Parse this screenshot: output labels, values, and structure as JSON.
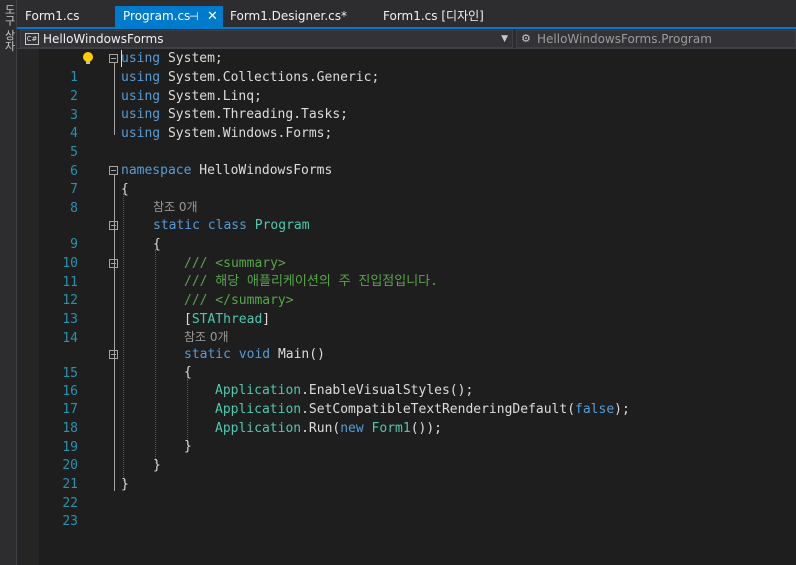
{
  "toolstrip": {
    "label": "도구 상자"
  },
  "tabs": [
    {
      "label": "Form1.cs",
      "active": false
    },
    {
      "label": "Program.cs",
      "active": true
    },
    {
      "label": "Form1.Designer.cs*",
      "active": false
    },
    {
      "label": "Form1.cs [디자인]",
      "active": false
    }
  ],
  "navbar": {
    "project": "HelloWindowsForms",
    "class": "HelloWindowsForms.Program"
  },
  "code": {
    "lines": [
      {
        "n": "1",
        "t": [
          "using",
          " System;"
        ]
      },
      {
        "n": "2",
        "t": [
          "using",
          " System.Collections.Generic;"
        ]
      },
      {
        "n": "3",
        "t": [
          "using",
          " System.Linq;"
        ]
      },
      {
        "n": "4",
        "t": [
          "using",
          " System.Threading.Tasks;"
        ]
      },
      {
        "n": "5",
        "t": [
          "using",
          " System.Windows.Forms;"
        ]
      },
      {
        "n": "6",
        "t": []
      },
      {
        "n": "7",
        "t": [
          "namespace",
          " HelloWindowsForms"
        ]
      },
      {
        "n": "8",
        "t": [
          "{"
        ]
      },
      {
        "hint": "참조 0개"
      },
      {
        "n": "9",
        "t": [
          "static",
          "class",
          "Program"
        ]
      },
      {
        "n": "10",
        "t": [
          "{"
        ]
      },
      {
        "n": "11",
        "t": [
          "/// <summary>"
        ]
      },
      {
        "n": "12",
        "t": [
          "/// 해당 애플리케이션의 주 진입점입니다."
        ]
      },
      {
        "n": "13",
        "t": [
          "/// </summary>"
        ]
      },
      {
        "n": "14",
        "t": [
          "[",
          "STAThread",
          "]"
        ]
      },
      {
        "hint": "참조 0개"
      },
      {
        "n": "15",
        "t": [
          "static",
          "void",
          "Main",
          "()"
        ]
      },
      {
        "n": "16",
        "t": [
          "{"
        ]
      },
      {
        "n": "17",
        "t": [
          "Application",
          ".EnableVisualStyles();"
        ]
      },
      {
        "n": "18",
        "t": [
          "Application",
          ".SetCompatibleTextRenderingDefault(",
          "false",
          ");"
        ]
      },
      {
        "n": "19",
        "t": [
          "Application",
          ".Run(",
          "new",
          "Form1",
          "());"
        ]
      },
      {
        "n": "20",
        "t": [
          "}"
        ]
      },
      {
        "n": "21",
        "t": [
          "}"
        ]
      },
      {
        "n": "22",
        "t": [
          "}"
        ]
      },
      {
        "n": "23",
        "t": []
      }
    ]
  },
  "icons": {
    "lightbulb": "lightbulb-icon",
    "pin": "pin-icon",
    "close": "close-icon",
    "csharp": "csharp-file-icon",
    "class": "class-icon"
  },
  "colors": {
    "keyword": "#569cd6",
    "type": "#4ec9b0",
    "comment": "#57a64a",
    "lineNumber": "#2b91af",
    "accent": "#007acc"
  }
}
